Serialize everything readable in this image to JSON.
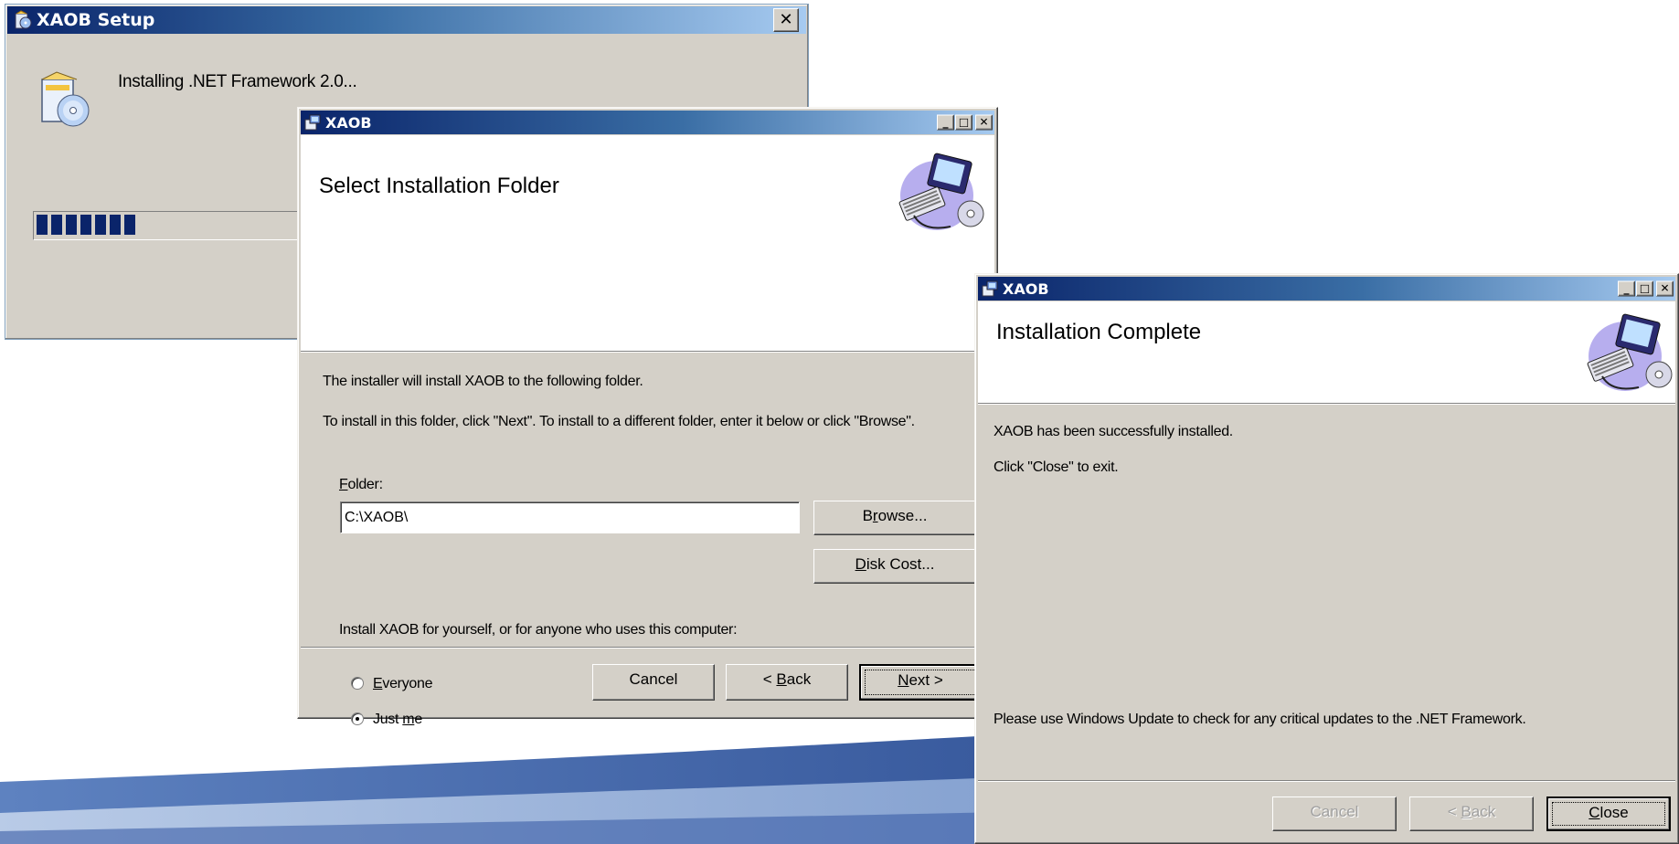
{
  "setup_window": {
    "title": "XAOB Setup",
    "message": "Installing .NET Framework 2.0...",
    "progress_percent": 25,
    "close_glyph": "✕",
    "icon": "installer-disc-icon"
  },
  "folder_dialog": {
    "title": "XAOB",
    "heading": "Select Installation Folder",
    "line1": "The installer will install XAOB to the following folder.",
    "line2": "To install in this folder, click \"Next\". To install to a different folder, enter it below or click \"Browse\".",
    "folder_label_accel": "F",
    "folder_label_rest": "older:",
    "folder_value": "C:\\XAOB\\",
    "browse_pre": "B",
    "browse_accel": "r",
    "browse_post": "owse...",
    "diskcost_accel": "D",
    "diskcost_post": "isk Cost...",
    "install_for_text": "Install XAOB for yourself, or for anyone who uses this computer:",
    "radio_everyone_accel": "E",
    "radio_everyone_rest": "veryone",
    "radio_justme_pre": "Just ",
    "radio_justme_accel": "m",
    "radio_justme_post": "e",
    "selected_option": "Just me",
    "cancel_label": "Cancel",
    "back_pre": "< ",
    "back_accel": "B",
    "back_post": "ack",
    "next_accel": "N",
    "next_post": "ext >",
    "icon": "computer-cd-icon"
  },
  "complete_dialog": {
    "title": "XAOB",
    "heading": "Installation Complete",
    "line1": "XAOB has been successfully installed.",
    "line2": "Click \"Close\" to exit.",
    "note": "Please use Windows Update to check for any critical updates to the .NET Framework.",
    "cancel_label": "Cancel",
    "back_pre": "< ",
    "back_accel": "B",
    "back_post": "ack",
    "close_accel": "C",
    "close_post": "lose",
    "icon": "computer-cd-icon"
  },
  "colors": {
    "titlebar_start": "#0a246a",
    "titlebar_end": "#a6caf0",
    "face": "#d4d0c8",
    "progress": "#0a246a",
    "swoosh_dark": "#1f3f86",
    "swoosh_light": "#7ea2d6"
  }
}
